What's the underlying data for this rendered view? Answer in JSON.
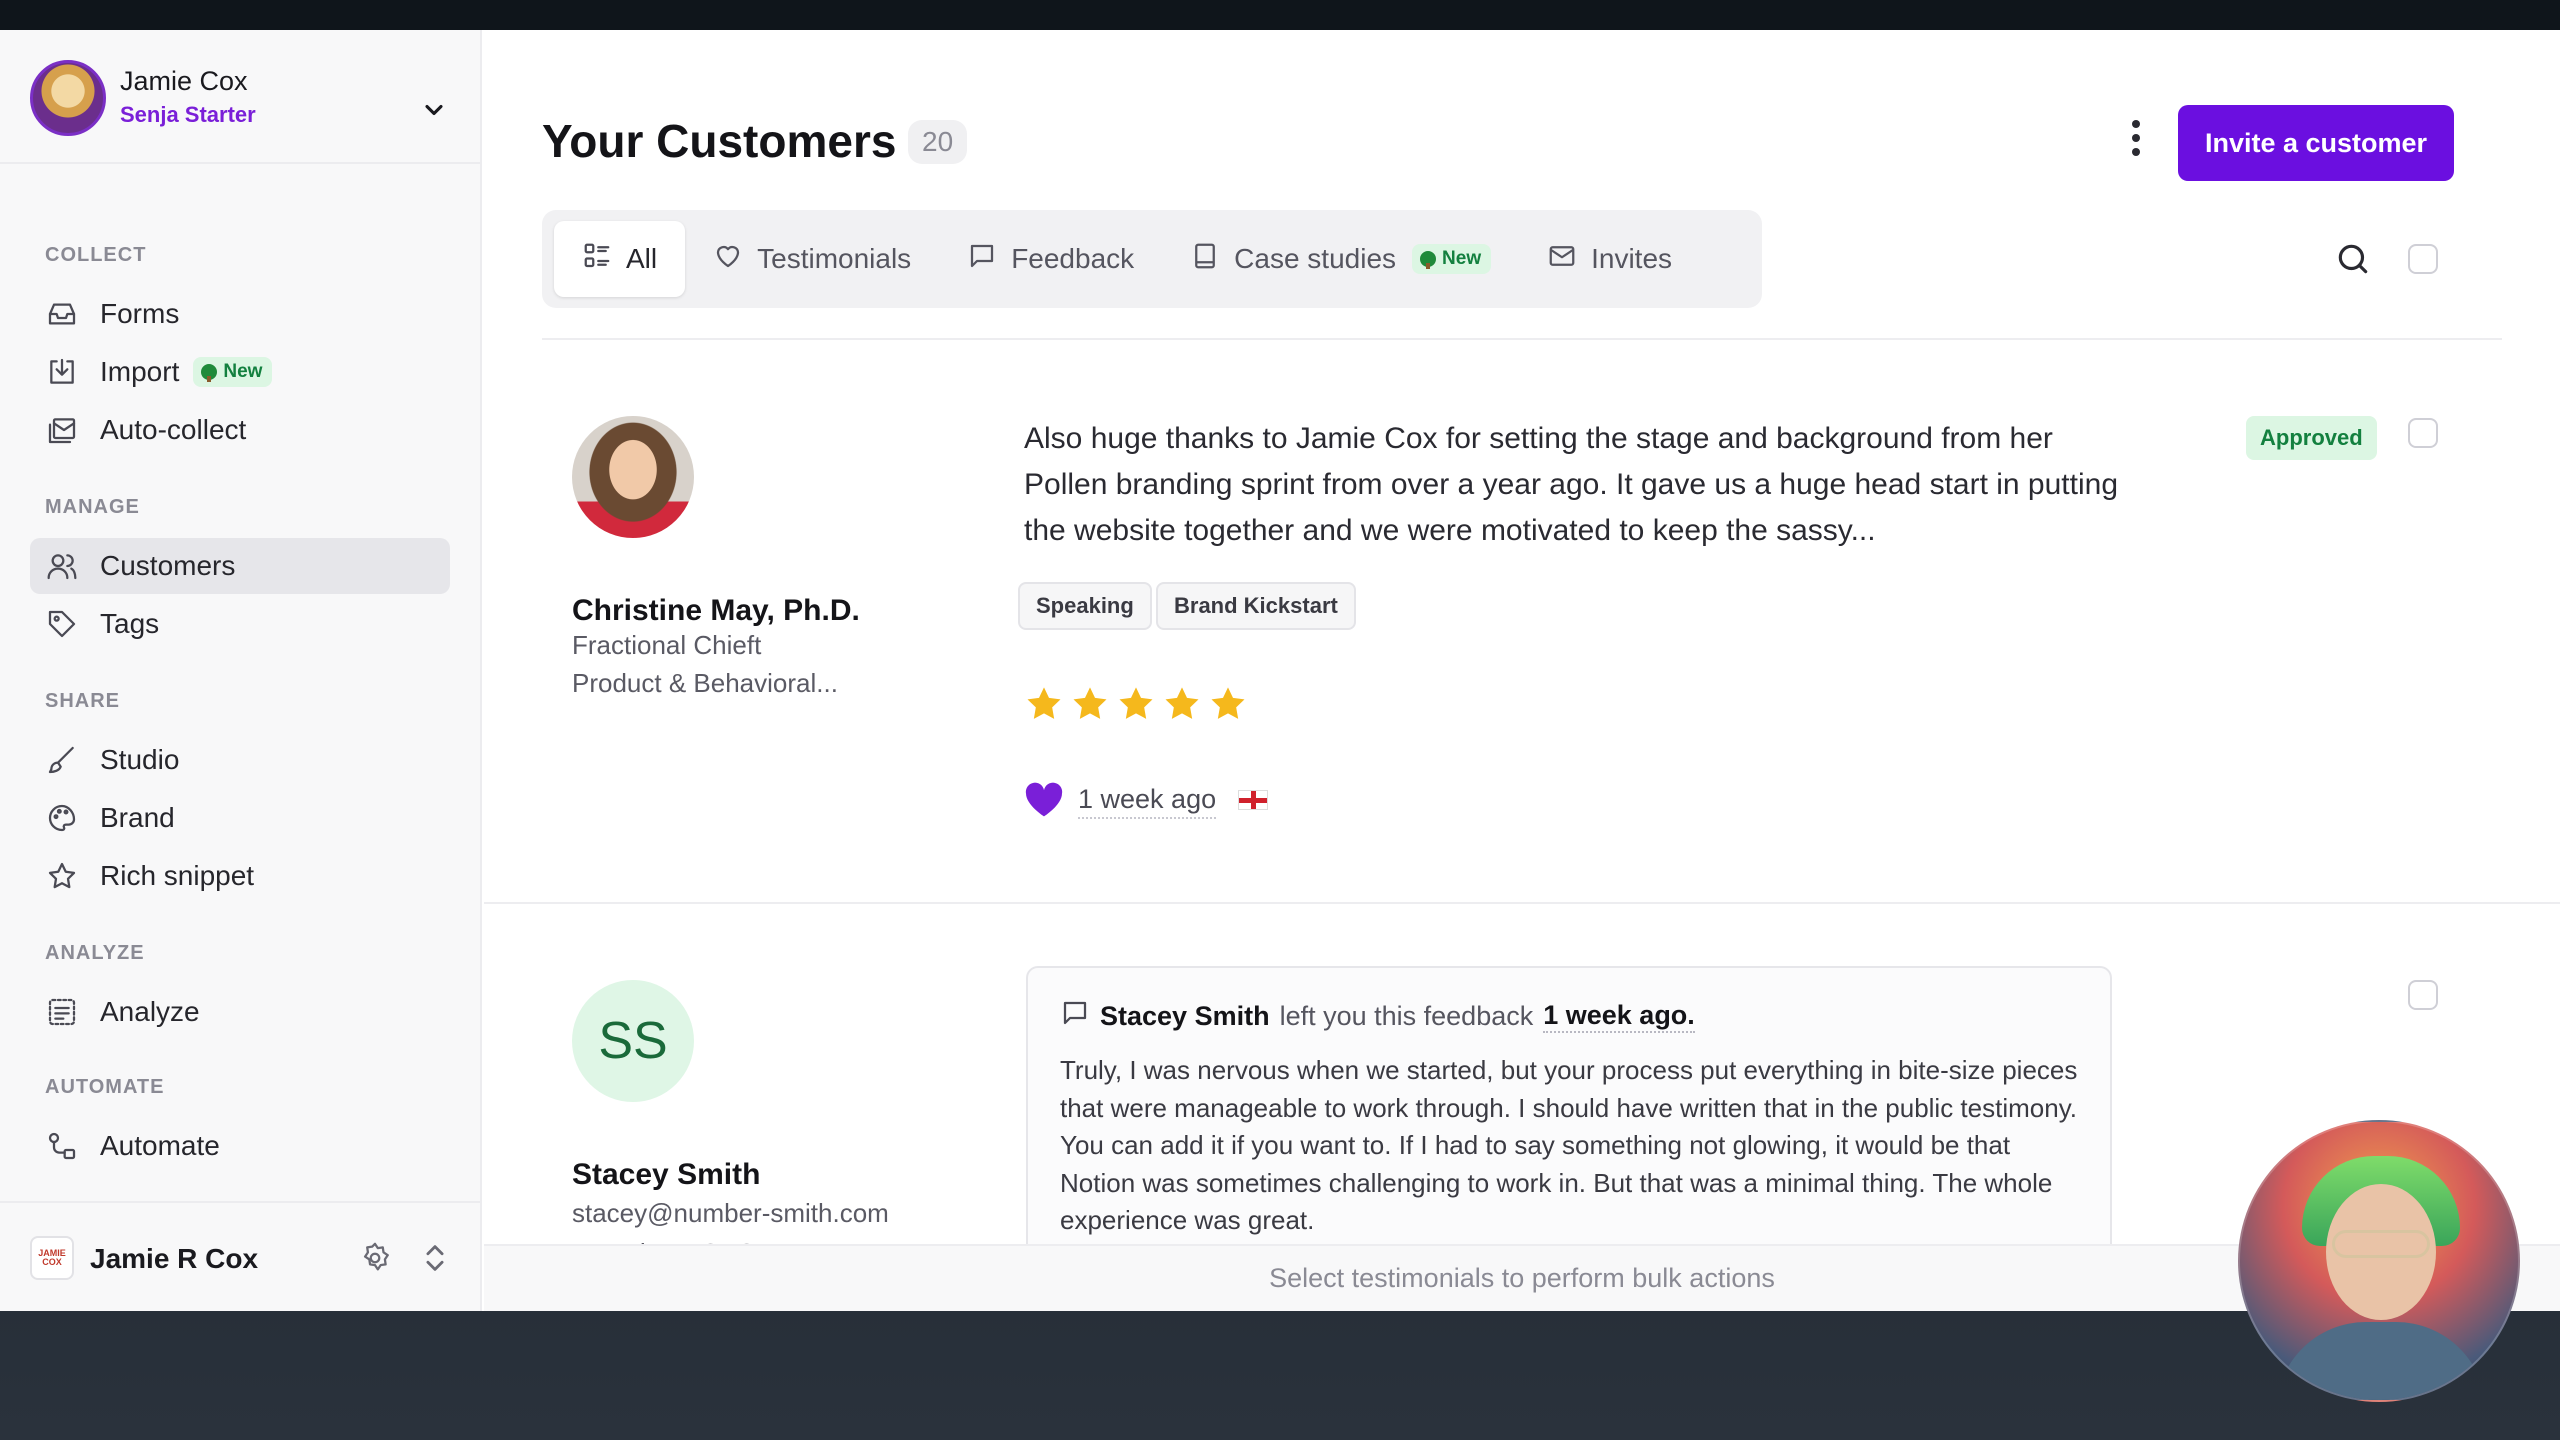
{
  "sidebar": {
    "user": {
      "name": "Jamie Cox",
      "plan": "Senja Starter"
    },
    "sections": {
      "collect": "COLLECT",
      "manage": "MANAGE",
      "share": "SHARE",
      "analyze": "ANALYZE",
      "automate": "AUTOMATE"
    },
    "items": {
      "forms": "Forms",
      "import": "Import",
      "import_badge": "New",
      "auto_collect": "Auto-collect",
      "customers": "Customers",
      "tags": "Tags",
      "studio": "Studio",
      "brand": "Brand",
      "rich_snippet": "Rich snippet",
      "analyze": "Analyze",
      "automate": "Automate"
    },
    "workspace": {
      "name": "Jamie R Cox",
      "logo_text": "JAMIE COX"
    }
  },
  "header": {
    "title": "Your Customers",
    "count": "20",
    "invite_label": "Invite a customer"
  },
  "tabs": {
    "all": "All",
    "testimonials": "Testimonials",
    "feedback": "Feedback",
    "case_studies": "Case studies",
    "case_studies_badge": "New",
    "invites": "Invites"
  },
  "cards": [
    {
      "name": "Christine May, Ph.D.",
      "title": "Fractional Chieft",
      "company": "Product & Behavioral...",
      "text": "Also huge thanks to Jamie Cox for setting the stage and background from her Pollen branding sprint from over a year ago. It gave us a huge head start in putting the website together and we were motivated to keep the sassy...",
      "status": "Approved",
      "tags": [
        "Speaking",
        "Brand Kickstart"
      ],
      "rating": 5,
      "time": "1 week ago"
    },
    {
      "initials": "SS",
      "name": "Stacey Smith",
      "email": "stacey@number-smith.com",
      "role": "Founder & CEO",
      "feedback_who": "Stacey Smith",
      "feedback_mid": "left you this feedback",
      "feedback_when": "1 week ago.",
      "text": "Truly, I was nervous when we started, but your process put everything in bite-size pieces that were manageable to work through. I should have written that in the public testimony. You can add it if you want to. If I had to say something not glowing, it would be that Notion was sometimes challenging to work in. But that was a minimal thing. The whole experience was great."
    }
  ],
  "bulk_bar": "Select testimonials to perform bulk actions",
  "colors": {
    "accent": "#6b0fe0",
    "plan": "#7a1fd8",
    "approved_bg": "#dcf6e3",
    "approved_text": "#13803f",
    "star": "#f5b81c"
  }
}
